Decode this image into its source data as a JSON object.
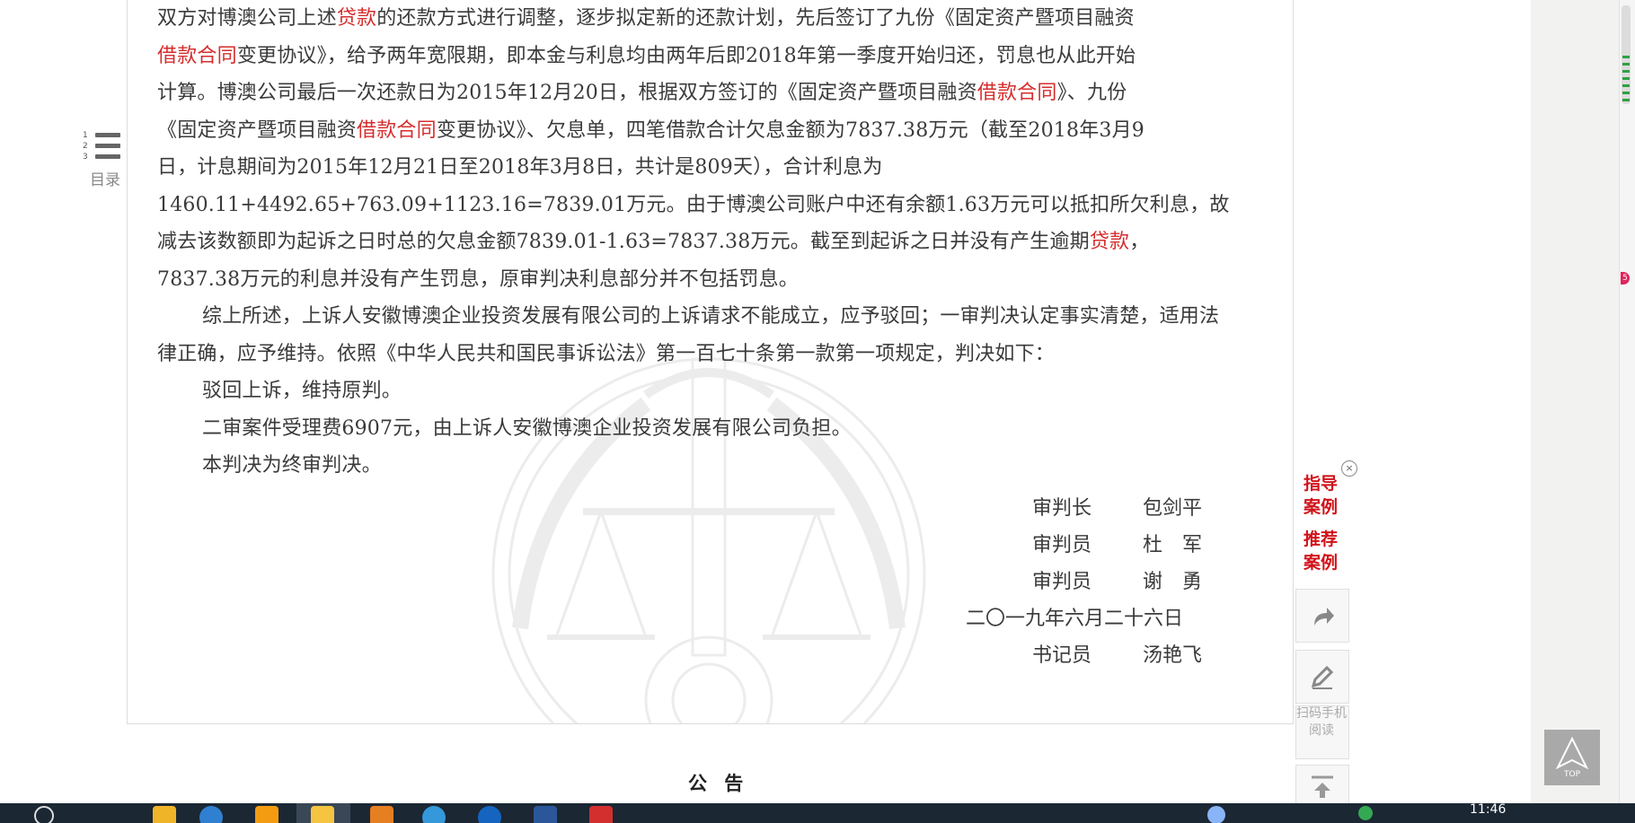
{
  "toc": {
    "numbers": [
      "1",
      "2",
      "3"
    ],
    "label": "目录"
  },
  "document": {
    "line1": {
      "a": "双方对博澳公司上述",
      "kw": "贷款",
      "b": "的还款方式进行调整，逐步拟定新的还款计划，先后签订了九份《固定资产暨项目融资"
    },
    "line2": {
      "kw": "借款合同",
      "b": "变更协议》，给予两年宽限期，即本金与利息均由两年后即2018年第一季度开始归还，罚息也从此开始"
    },
    "line3": {
      "a": "计算。博澳公司最后一次还款日为2015年12月20日，根据双方签订的《固定资产暨项目融资",
      "kw": "借款合同",
      "b": "》、九份"
    },
    "line4": {
      "a": "《固定资产暨项目融资",
      "kw": "借款合同",
      "b": "变更协议》、欠息单，四笔借款合计欠息金额为7837.38万元（截至2018年3月9"
    },
    "line5": "日，计息期间为2015年12月21日至2018年3月8日，共计是809天），合计利息为",
    "line6": "1460.11+4492.65+763.09+1123.16=7839.01万元。由于博澳公司账户中还有余额1.63万元可以抵扣所欠利息，故",
    "line7": {
      "a": "减去该数额即为起诉之日时总的欠息金额7839.01-1.63=7837.38万元。截至到起诉之日并没有产生逾期",
      "kw": "贷款",
      "b": "，"
    },
    "line8": "7837.38万元的利息并没有产生罚息，原审判决利息部分并不包括罚息。",
    "para2": "综上所述，上诉人安徽博澳企业投资发展有限公司的上诉请求不能成立，应予驳回；一审判决认定事实清楚，适用法律正确，应予维持。依照《中华人民共和国民事诉讼法》第一百七十条第一款第一项规定，判决如下：",
    "para3": "驳回上诉，维持原判。",
    "para4": "二审案件受理费6907元，由上诉人安徽博澳企业投资发展有限公司负担。",
    "para5": "本判决为终审判决。"
  },
  "signatures": [
    {
      "role": "审判长",
      "name": "包剑平"
    },
    {
      "role": "审判员",
      "name": "杜　军"
    },
    {
      "role": "审判员",
      "name": "谢　勇"
    },
    {
      "date": "二〇一九年六月二十六日"
    },
    {
      "role": "书记员",
      "name": "汤艳飞"
    }
  ],
  "side_tools": {
    "close": "×",
    "guide_cases": "指导案例",
    "recommended_cases": "推荐案例",
    "share_icon": "share-arrow-icon",
    "edit_icon": "pencil-icon",
    "qr_text": "扫码手机阅读",
    "pin_icon": "scroll-to-top-line-icon"
  },
  "top_button": {
    "label": "TOP"
  },
  "notice_title": "公 告",
  "taskbar": {
    "time": "11:46"
  },
  "colors": {
    "keyword": "#d62d2d",
    "side_link": "#d0121a",
    "taskbar": "#1b2733"
  }
}
